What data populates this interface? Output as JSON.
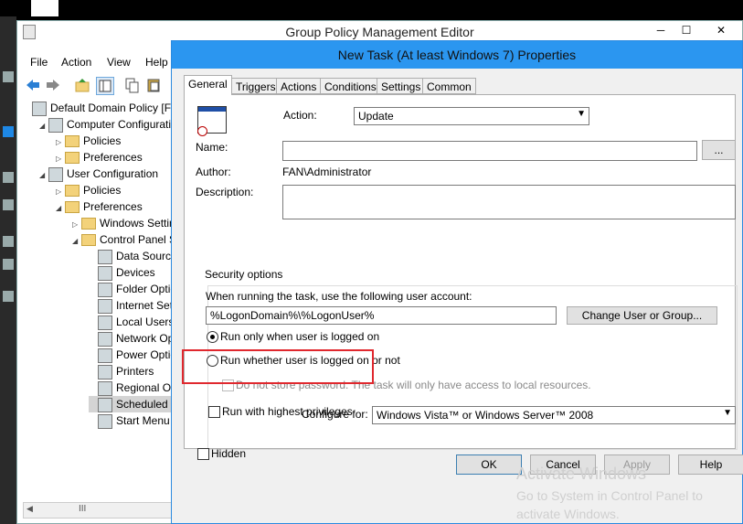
{
  "main_window": {
    "title": "Group Policy Management Editor",
    "min_label": "─",
    "max_label": "☐",
    "close_label": "✕"
  },
  "menu": {
    "file": "File",
    "action": "Action",
    "view": "View",
    "help": "Help"
  },
  "tree": [
    {
      "label": "Default Domain Policy [FIL",
      "indent": 0,
      "icon": "policy",
      "tri": ""
    },
    {
      "label": "Computer Configurati",
      "indent": 1,
      "icon": "computer",
      "tri": "◢"
    },
    {
      "label": "Policies",
      "indent": 2,
      "icon": "folder",
      "tri": "▷"
    },
    {
      "label": "Preferences",
      "indent": 2,
      "icon": "folder",
      "tri": "▷"
    },
    {
      "label": "User Configuration",
      "indent": 1,
      "icon": "user",
      "tri": "◢"
    },
    {
      "label": "Policies",
      "indent": 2,
      "icon": "folder",
      "tri": "▷"
    },
    {
      "label": "Preferences",
      "indent": 2,
      "icon": "folder",
      "tri": "◢"
    },
    {
      "label": "Windows Settin",
      "indent": 3,
      "icon": "folder",
      "tri": "▷"
    },
    {
      "label": "Control Panel S",
      "indent": 3,
      "icon": "folder",
      "tri": "◢"
    },
    {
      "label": "Data Source",
      "indent": 4,
      "icon": "item",
      "tri": ""
    },
    {
      "label": "Devices",
      "indent": 4,
      "icon": "item",
      "tri": ""
    },
    {
      "label": "Folder Optic",
      "indent": 4,
      "icon": "item",
      "tri": ""
    },
    {
      "label": "Internet Set",
      "indent": 4,
      "icon": "item",
      "tri": ""
    },
    {
      "label": "Local Users",
      "indent": 4,
      "icon": "item",
      "tri": ""
    },
    {
      "label": "Network Op",
      "indent": 4,
      "icon": "item",
      "tri": ""
    },
    {
      "label": "Power Optio",
      "indent": 4,
      "icon": "item",
      "tri": ""
    },
    {
      "label": "Printers",
      "indent": 4,
      "icon": "item",
      "tri": ""
    },
    {
      "label": "Regional Op",
      "indent": 4,
      "icon": "item",
      "tri": ""
    },
    {
      "label": "Scheduled T",
      "indent": 4,
      "icon": "item",
      "tri": "",
      "selected": true
    },
    {
      "label": "Start Menu",
      "indent": 4,
      "icon": "item",
      "tri": ""
    }
  ],
  "scroll_thumb": "III",
  "dialog": {
    "title": "New Task (At least Windows 7) Properties",
    "tabs": [
      "General",
      "Triggers",
      "Actions",
      "Conditions",
      "Settings",
      "Common"
    ],
    "action_label": "Action:",
    "action_value": "Update",
    "name_label": "Name:",
    "name_value": "",
    "browse_label": "...",
    "author_label": "Author:",
    "author_value": "FAN\\Administrator",
    "description_label": "Description:",
    "description_value": "",
    "security_group_label": "Security options",
    "user_account_prompt": "When running the task, use the following user account:",
    "user_account_value": "%LogonDomain%\\%LogonUser%",
    "change_user_label": "Change User or Group...",
    "radio_logged_on": "Run only when user is logged on",
    "radio_whether": "Run whether user is logged on or not",
    "no_store_password": "Do not store password. The task will only have access to local resources.",
    "highest_privileges": "Run with highest privileges",
    "hidden_label": "Hidden",
    "configure_for_label": "Configure for:",
    "configure_for_value": "Windows Vista™ or Windows Server™ 2008",
    "ok": "OK",
    "cancel": "Cancel",
    "apply": "Apply",
    "help": "Help"
  },
  "watermark": {
    "line1": "Activate Windows",
    "line2": "Go to System in Control Panel to",
    "line3": "activate Windows."
  },
  "colors": {
    "dialog_title_bg": "#2b96f0",
    "highlight_box": "#e0282e"
  }
}
